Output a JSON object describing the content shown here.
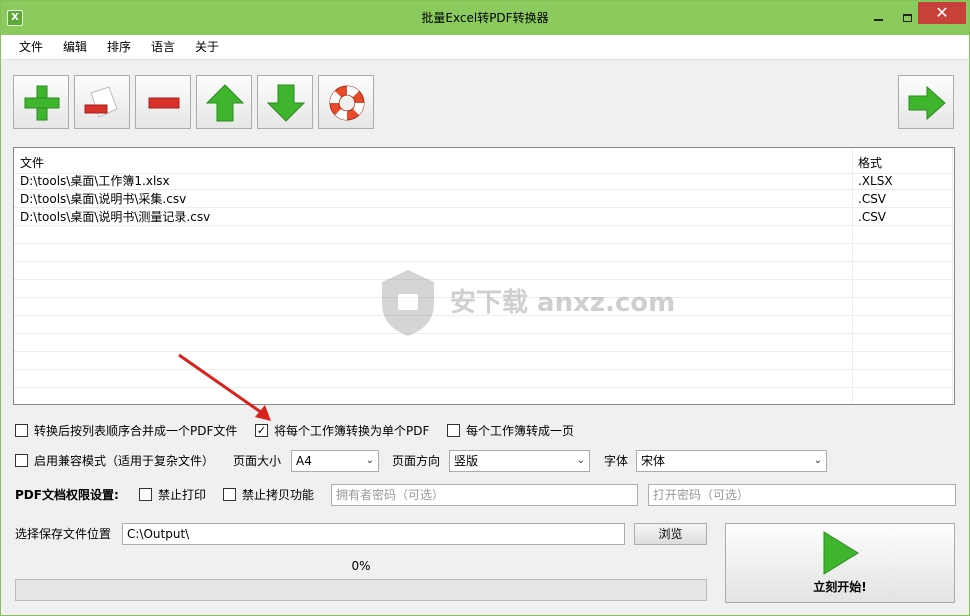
{
  "window": {
    "title": "批量Excel转PDF转换器"
  },
  "menu": {
    "items": [
      "文件",
      "编辑",
      "排序",
      "语言",
      "关于"
    ]
  },
  "toolbar": {
    "buttons": [
      {
        "icon": "add-icon"
      },
      {
        "icon": "remove-file-icon"
      },
      {
        "icon": "minus-icon"
      },
      {
        "icon": "move-up-icon"
      },
      {
        "icon": "move-down-icon"
      },
      {
        "icon": "help-lifebuoy-icon"
      }
    ],
    "next_icon": "arrow-right-icon"
  },
  "filelist": {
    "columns": [
      "文件",
      "格式"
    ],
    "rows": [
      {
        "file": "D:\\tools\\桌面\\工作簿1.xlsx",
        "format": ".XLSX"
      },
      {
        "file": "D:\\tools\\桌面\\说明书\\采集.csv",
        "format": ".CSV"
      },
      {
        "file": "D:\\tools\\桌面\\说明书\\测量记录.csv",
        "format": ".CSV"
      }
    ],
    "watermark": "安下载 anxz.com"
  },
  "options": {
    "merge": {
      "label": "转换后按列表顺序合并成一个PDF文件",
      "checked": false
    },
    "single_pdf": {
      "label": "将每个工作簿转换为单个PDF",
      "checked": true
    },
    "one_page": {
      "label": "每个工作簿转成一页",
      "checked": false
    },
    "compat": {
      "label": "启用兼容模式（适用于复杂文件）",
      "checked": false
    },
    "page_size_label": "页面大小",
    "page_size_value": "A4",
    "orientation_label": "页面方向",
    "orientation_value": "竖版",
    "font_label": "字体",
    "font_value": "宋体",
    "perm_label": "PDF文档权限设置:",
    "no_print": {
      "label": "禁止打印",
      "checked": false
    },
    "no_copy": {
      "label": "禁止拷贝功能",
      "checked": false
    },
    "owner_pwd_placeholder": "拥有者密码（可选）",
    "open_pwd_placeholder": "打开密码（可选）"
  },
  "output": {
    "label": "选择保存文件位置",
    "path": "C:\\Output\\",
    "browse_label": "浏览"
  },
  "progress": {
    "text": "0%",
    "value": 0
  },
  "start": {
    "label": "立刻开始!"
  },
  "colors": {
    "titlebar": "#8bcb5e",
    "close": "#c7403a",
    "icon_green": "#3fb52e",
    "icon_red": "#d9302a"
  }
}
